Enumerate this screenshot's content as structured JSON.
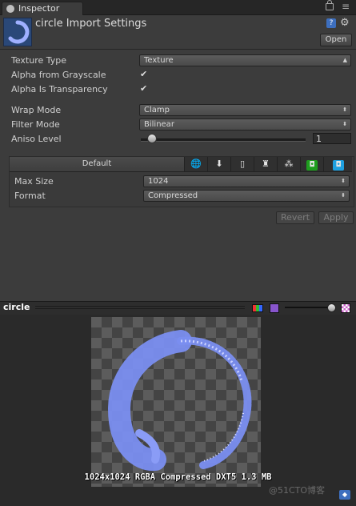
{
  "tab": {
    "title": "Inspector"
  },
  "header": {
    "title": "circle Import Settings",
    "open_label": "Open"
  },
  "properties": {
    "texture_type_label": "Texture Type",
    "texture_type_value": "Texture",
    "alpha_gray_label": "Alpha from Grayscale",
    "alpha_gray_checked": true,
    "alpha_transp_label": "Alpha Is Transparency",
    "alpha_transp_checked": true,
    "wrap_label": "Wrap Mode",
    "wrap_value": "Clamp",
    "filter_label": "Filter Mode",
    "filter_value": "Bilinear",
    "aniso_label": "Aniso Level",
    "aniso_value": "1"
  },
  "platform": {
    "default_tab": "Default",
    "tabs": [
      "web-icon",
      "download-icon",
      "phone-icon",
      "android-icon",
      "blackberry-icon",
      "xbox-icon",
      "windows-store-icon"
    ],
    "max_size_label": "Max Size",
    "max_size_value": "1024",
    "format_label": "Format",
    "format_value": "Compressed"
  },
  "buttons": {
    "revert": "Revert",
    "apply": "Apply"
  },
  "preview": {
    "title": "circle",
    "info": "1024x1024  RGBA Compressed DXT5  1.3 MB",
    "watermark": "@51CTO博客"
  },
  "colors": {
    "panel_bg": "#3c3c3c",
    "ring_blue": "#7a8ef0",
    "accent_blue": "#3d6fbf"
  }
}
